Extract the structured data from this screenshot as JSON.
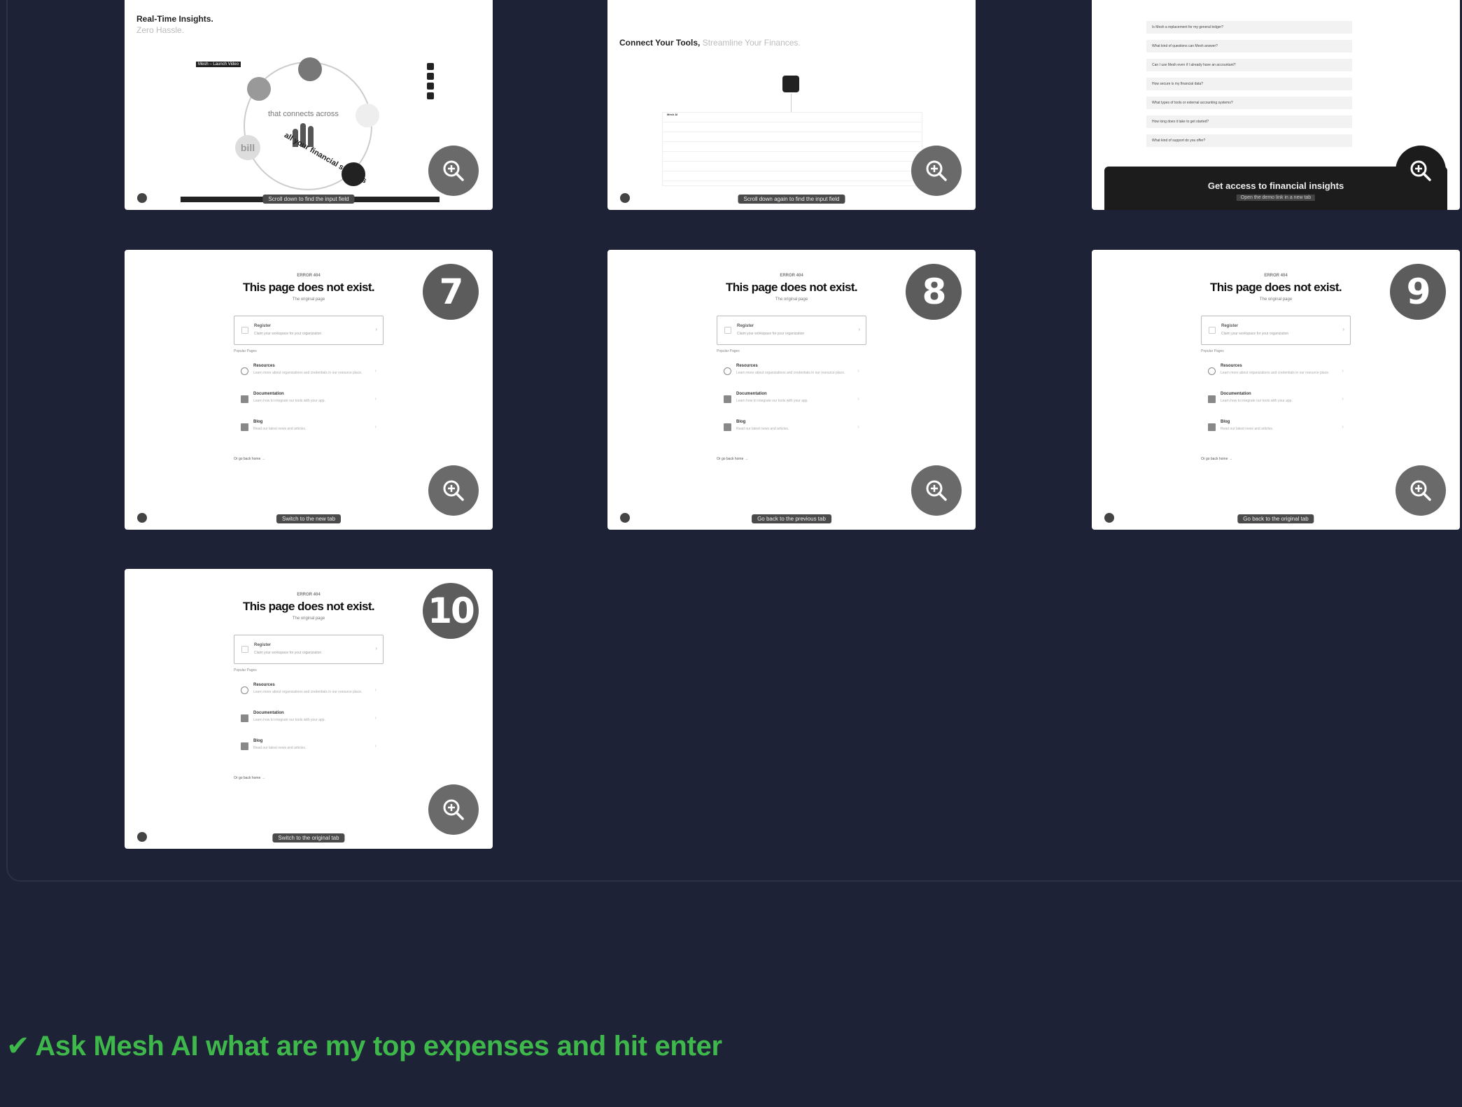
{
  "colors": {
    "background": "#1e2236",
    "card": "#ffffff",
    "badge": "#5c5c5c",
    "task_green": "#3eb84a"
  },
  "cards_top": {
    "card4": {
      "title": "Real-Time Insights.",
      "subtitle": "Zero Hassle.",
      "tag": "Mesh – Launch Video",
      "center_text": "that connects across",
      "logo_word": "mesh",
      "arc_text": "all your financial systems",
      "bill_text": "bill",
      "status_pill": "Scroll down to find the input field"
    },
    "card5": {
      "title": "Connect Your Tools,",
      "title_muted": "Streamline Your Finances.",
      "table_head": "Mesh AI",
      "status_pill": "Scroll down again to find the input field"
    },
    "card6": {
      "faq": [
        "Is Mesh a replacement for my general ledger?",
        "What kind of questions can Mesh answer?",
        "Can I use Mesh even if I already have an accountant?",
        "How secure is my financial data?",
        "What types of tools or external accounting systems?",
        "How long does it take to get started?",
        "What kind of support do you offer?"
      ],
      "banner_title": "Get access to financial insights",
      "banner_sub": "Open the demo link in a new tab"
    }
  },
  "error_cards": [
    {
      "number": "7",
      "code": "ERROR 404",
      "title": "This page does not exist.",
      "sub": "The original page",
      "register_title": "Register",
      "register_desc": "Claim your workspace for your organization",
      "popular_label": "Popular Pages",
      "items": [
        {
          "title": "Resources",
          "desc": "Learn more about organizations and credentials in our resource place."
        },
        {
          "title": "Documentation",
          "desc": "Learn how to integrate our tools with your app."
        },
        {
          "title": "Blog",
          "desc": "Read our latest news and articles."
        }
      ],
      "back": "Or go back home →",
      "status_pill": "Switch to the new tab"
    },
    {
      "number": "8",
      "code": "ERROR 404",
      "title": "This page does not exist.",
      "sub": "The original page",
      "register_title": "Register",
      "register_desc": "Claim your workspace for your organization",
      "popular_label": "Popular Pages",
      "items": [
        {
          "title": "Resources",
          "desc": "Learn more about organizations and credentials in our resource place."
        },
        {
          "title": "Documentation",
          "desc": "Learn how to integrate our tools with your app."
        },
        {
          "title": "Blog",
          "desc": "Read our latest news and articles."
        }
      ],
      "back": "Or go back home →",
      "status_pill": "Go back to the previous tab"
    },
    {
      "number": "9",
      "code": "ERROR 404",
      "title": "This page does not exist.",
      "sub": "The original page",
      "register_title": "Register",
      "register_desc": "Claim your workspace for your organization",
      "popular_label": "Popular Pages",
      "items": [
        {
          "title": "Resources",
          "desc": "Learn more about organizations and credentials in our resource place."
        },
        {
          "title": "Documentation",
          "desc": "Learn how to integrate our tools with your app."
        },
        {
          "title": "Blog",
          "desc": "Read our latest news and articles."
        }
      ],
      "back": "Or go back home →",
      "status_pill": "Go back to the original tab"
    },
    {
      "number": "10",
      "code": "ERROR 404",
      "title": "This page does not exist.",
      "sub": "The original page",
      "register_title": "Register",
      "register_desc": "Claim your workspace for your organization",
      "popular_label": "Popular Pages",
      "items": [
        {
          "title": "Resources",
          "desc": "Learn more about organizations and credentials in our resource place."
        },
        {
          "title": "Documentation",
          "desc": "Learn how to integrate our tools with your app."
        },
        {
          "title": "Blog",
          "desc": "Read our latest news and articles."
        }
      ],
      "back": "Or go back home →",
      "status_pill": "Switch to the original tab"
    }
  ],
  "task": {
    "check": "✔",
    "text": "Ask Mesh AI what are my top expenses and hit enter"
  }
}
